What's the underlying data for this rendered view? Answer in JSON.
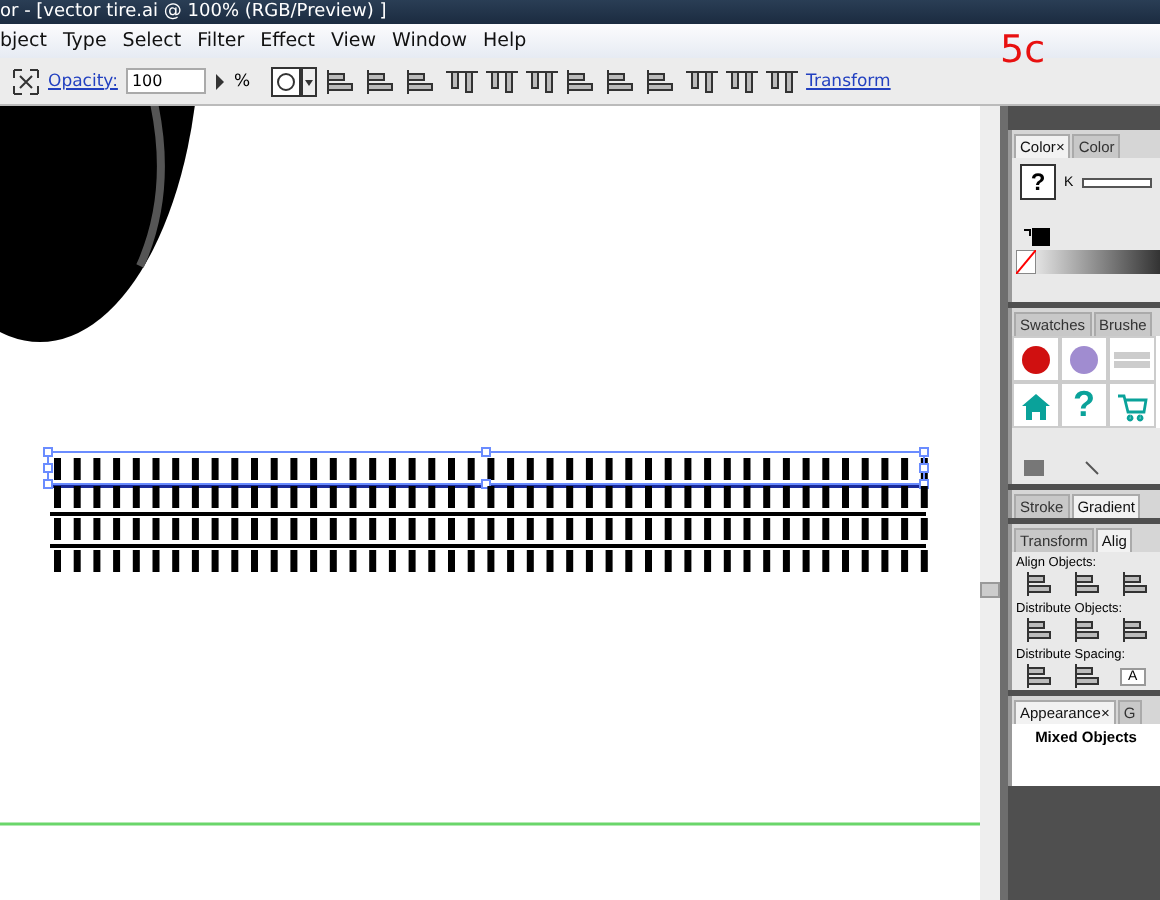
{
  "window": {
    "title": "or - [vector tire.ai @ 100% (RGB/Preview) ]"
  },
  "annotation": "5c",
  "menu": [
    "bject",
    "Type",
    "Select",
    "Filter",
    "Effect",
    "View",
    "Window",
    "Help"
  ],
  "control_bar": {
    "opacity_label": "Opacity:",
    "opacity_value": "100",
    "percent": "%",
    "transform_link": "Transform"
  },
  "canvas": {
    "stripe_rows": [
      {
        "selected": true
      },
      {
        "selected": false
      },
      {
        "selected": false
      },
      {
        "selected": false
      }
    ]
  },
  "panels": [
    {
      "kind": "color",
      "tabs": [
        {
          "label": "Color",
          "close": "×",
          "selected": true
        },
        {
          "label": "Color",
          "selected": false
        }
      ],
      "channel": "K",
      "fill_glyph": "?"
    },
    {
      "kind": "swatches",
      "tabs": [
        {
          "label": "Swatches",
          "selected": false
        },
        {
          "label": "Brushe",
          "selected": false
        }
      ],
      "glyph": "?"
    },
    {
      "kind": "stroke",
      "tabs": [
        {
          "label": "Stroke",
          "selected": false
        },
        {
          "label": "Gradient",
          "selected": true
        }
      ]
    },
    {
      "kind": "align",
      "tabs": [
        {
          "label": "Transform",
          "selected": false
        },
        {
          "label": "Alig",
          "selected": true
        }
      ],
      "sections": [
        "Align Objects:",
        "Distribute Objects:",
        "Distribute Spacing:"
      ],
      "spacing_value": "A"
    },
    {
      "kind": "appearance",
      "tabs": [
        {
          "label": "Appearance",
          "close": "×",
          "selected": true
        },
        {
          "label": "G",
          "selected": false
        }
      ],
      "heading": "Mixed Objects"
    }
  ]
}
